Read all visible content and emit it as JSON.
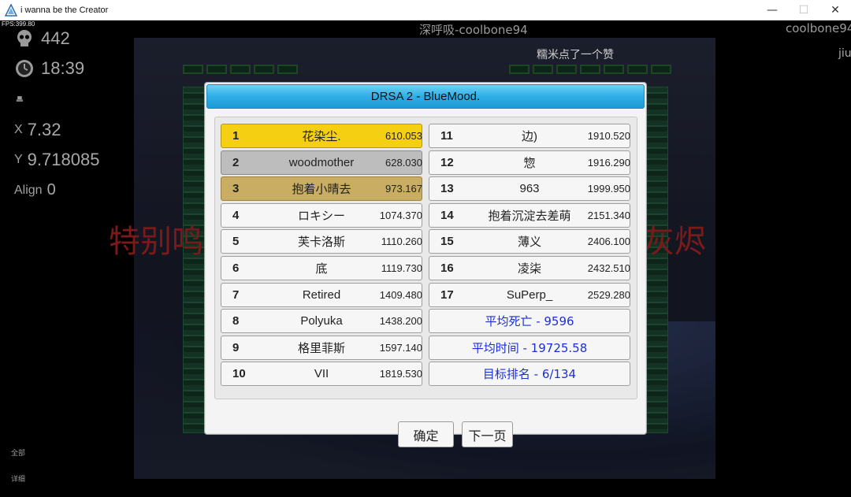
{
  "window": {
    "title": "i wanna be the Creator",
    "minimize": "—",
    "maximize": "☐",
    "close": "✕"
  },
  "hud": {
    "fps": "FPS:399.80",
    "deaths": "442",
    "time": "18:39",
    "x_label": "X",
    "x_value": "7.32",
    "y_label": "Y",
    "y_value": "9.718085",
    "align_label": "Align",
    "align_value": "0",
    "bottom_1": "全部",
    "bottom_2": "详细"
  },
  "danmaku": {
    "line1": "深呼吸-coolbone94",
    "line2": "coolbone94",
    "line3": "糯米点了一个赞",
    "line4": "jiu",
    "red_left": "特别鸣",
    "red_right": "灰烬"
  },
  "dialog": {
    "title": "DRSA 2 - BlueMood.",
    "left_rows": [
      {
        "rank": "1",
        "name": "花染尘.",
        "score": "610.053"
      },
      {
        "rank": "2",
        "name": "woodmother",
        "score": "628.030"
      },
      {
        "rank": "3",
        "name": "抱着小晴去",
        "score": "973.167"
      },
      {
        "rank": "4",
        "name": "ロキシー",
        "score": "1074.370"
      },
      {
        "rank": "5",
        "name": "芙卡洛斯",
        "score": "1110.260"
      },
      {
        "rank": "6",
        "name": "底",
        "score": "1119.730"
      },
      {
        "rank": "7",
        "name": "Retired",
        "score": "1409.480"
      },
      {
        "rank": "8",
        "name": "Polyuka",
        "score": "1438.200"
      },
      {
        "rank": "9",
        "name": "格里菲斯",
        "score": "1597.140"
      },
      {
        "rank": "10",
        "name": "VII",
        "score": "1819.530"
      }
    ],
    "right_rows": [
      {
        "rank": "11",
        "name": "边)",
        "score": "1910.520"
      },
      {
        "rank": "12",
        "name": "惣",
        "score": "1916.290"
      },
      {
        "rank": "13",
        "name": "963",
        "score": "1999.950"
      },
      {
        "rank": "14",
        "name": "抱着沉淀去差萌",
        "score": "2151.340"
      },
      {
        "rank": "15",
        "name": "薄义",
        "score": "2406.100"
      },
      {
        "rank": "16",
        "name": "凌柒",
        "score": "2432.510"
      },
      {
        "rank": "17",
        "name": "SuPerp_",
        "score": "2529.280"
      }
    ],
    "stats": {
      "avg_deaths": "平均死亡 - 9596",
      "avg_time": "平均时间 - 19725.58",
      "target_rank": "目标排名 - 6/134"
    },
    "buttons": {
      "ok": "确定",
      "next": "下一页"
    }
  },
  "colors": {
    "gold": "#f4cf12",
    "silver": "#bdbdbd",
    "bronze": "#c8ad62",
    "header_blue": "#2eaee6",
    "stat_blue": "#1a2fd8"
  }
}
